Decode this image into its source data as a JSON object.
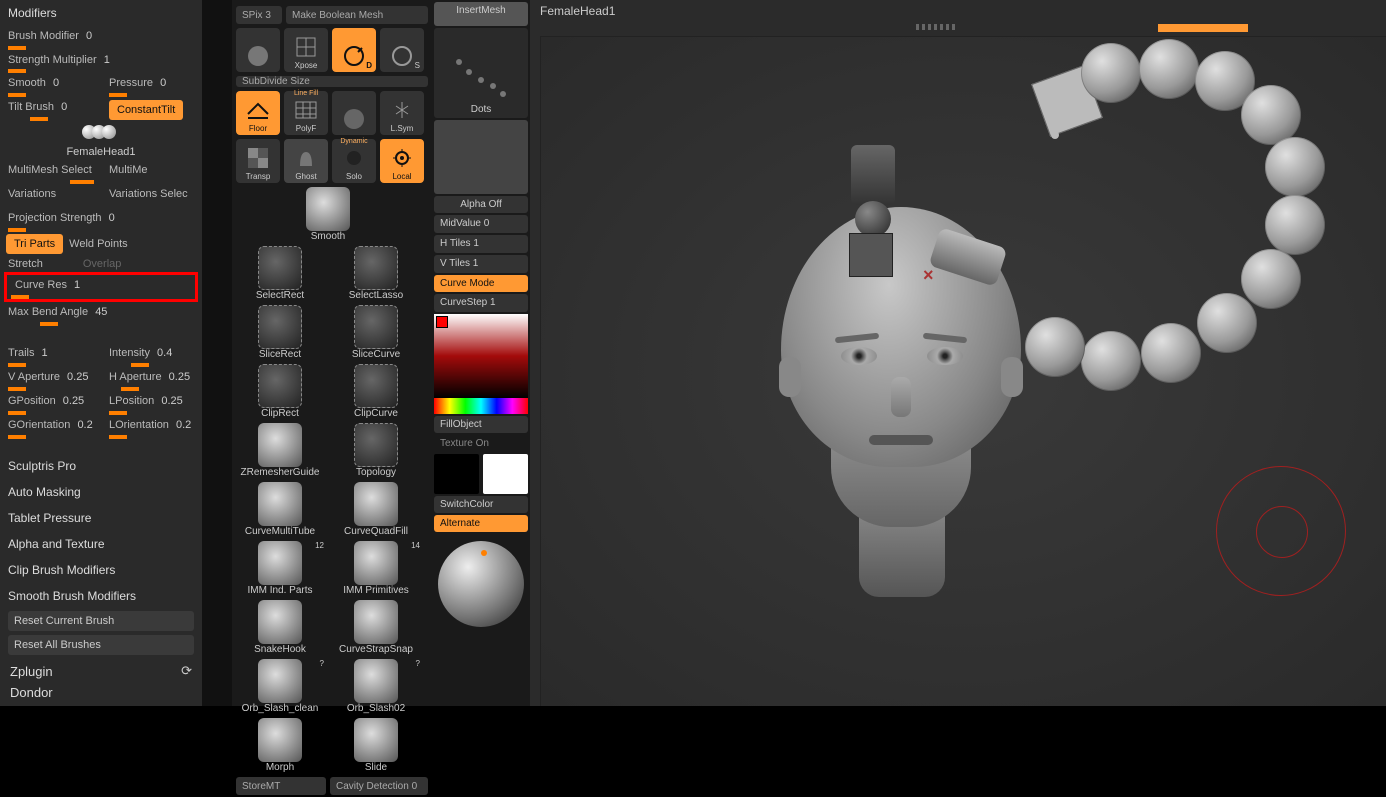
{
  "canvas": {
    "title": "FemaleHead1"
  },
  "left": {
    "header": "Modifiers",
    "brush_modifier": {
      "label": "Brush Modifier",
      "value": "0"
    },
    "strength_mult": {
      "label": "Strength Multiplier",
      "value": "1"
    },
    "smooth": {
      "label": "Smooth",
      "value": "0"
    },
    "pressure": {
      "label": "Pressure",
      "value": "0"
    },
    "tilt": {
      "label": "Tilt Brush",
      "value": "0"
    },
    "constant_tilt": "ConstantTilt",
    "brush_preview": "FemaleHead1",
    "multimesh": {
      "label": "MultiMesh Select",
      "label2": "MultiMe"
    },
    "variations": {
      "label": "Variations",
      "label2": "Variations Selec"
    },
    "proj": {
      "label": "Projection Strength",
      "value": "0"
    },
    "tri_parts": "Tri Parts",
    "weld_points": "Weld Points",
    "stretch": "Stretch",
    "overlap": "Overlap",
    "curve_res": {
      "label": "Curve Res",
      "value": "1"
    },
    "max_bend": {
      "label": "Max Bend Angle",
      "value": "45"
    },
    "trails": {
      "label": "Trails",
      "value": "1"
    },
    "intensity": {
      "label": "Intensity",
      "value": "0.4"
    },
    "vap": {
      "label": "V Aperture",
      "value": "0.25"
    },
    "hap": {
      "label": "H Aperture",
      "value": "0.25"
    },
    "gpos": {
      "label": "GPosition",
      "value": "0.25"
    },
    "lpos": {
      "label": "LPosition",
      "value": "0.25"
    },
    "gor": {
      "label": "GOrientation",
      "value": "0.2"
    },
    "lor": {
      "label": "LOrientation",
      "value": "0.2"
    },
    "cats": [
      "Sculptris Pro",
      "Auto Masking",
      "Tablet Pressure",
      "Alpha and Texture",
      "Clip Brush Modifiers",
      "Smooth Brush Modifiers"
    ],
    "reset_current": "Reset Current Brush",
    "reset_all": "Reset All Brushes",
    "zplugin": "Zplugin",
    "render": "Dondor"
  },
  "mid": {
    "spix": {
      "label": "SPix",
      "value": "3"
    },
    "make_bool": "Make Boolean Mesh",
    "subdiv": "SubDivide Size",
    "toggles": {
      "xpose": "Xpose",
      "d": "D",
      "s": "S",
      "floor": "Floor",
      "polyf": "PolyF",
      "linefill": "Line Fill",
      "lsym": "L.Sym",
      "transp": "Transp",
      "ghost": "Ghost",
      "solo": "Solo",
      "local": "Local",
      "dynamic": "Dynamic"
    },
    "brushes": [
      "Smooth",
      "SelectRect",
      "SelectLasso",
      "SliceRect",
      "SliceCurve",
      "ClipRect",
      "ClipCurve",
      "ZRemesherGuide",
      "Topology",
      "CurveMultiTube",
      "CurveQuadFill",
      "IMM Ind. Parts",
      "IMM Primitives",
      "SnakeHook",
      "CurveStrapSnap",
      "Orb_Slash_clean",
      "Orb_Slash02",
      "Morph",
      "Slide"
    ],
    "counts": {
      "imm_ind": "12",
      "imm_prim": "14"
    },
    "storemt": "StoreMT",
    "cavity": {
      "label": "Cavity Detection",
      "value": "0"
    }
  },
  "right": {
    "insertmesh": "InsertMesh",
    "dots": "Dots",
    "alpha_off": "Alpha Off",
    "midvalue": {
      "label": "MidValue",
      "value": "0"
    },
    "htiles": {
      "label": "H Tiles",
      "value": "1"
    },
    "vtiles": {
      "label": "V Tiles",
      "value": "1"
    },
    "curvemode": "Curve Mode",
    "curvestep": {
      "label": "CurveStep",
      "value": "1"
    },
    "fillobject": "FillObject",
    "texture_on": "Texture On",
    "switchcolor": "SwitchColor",
    "alternate": "Alternate"
  }
}
